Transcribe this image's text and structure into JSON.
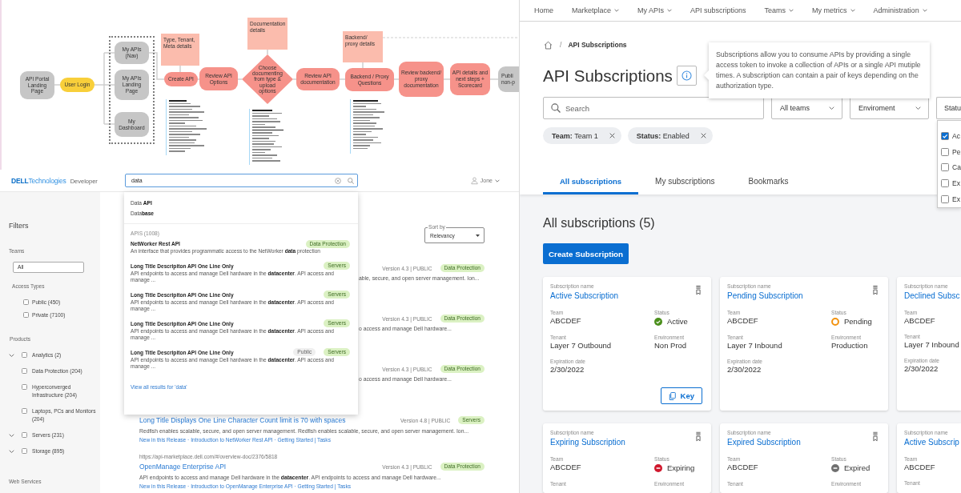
{
  "flowchart": {
    "nodes": [
      {
        "label": "API Portal Landing Page",
        "kind": "process",
        "color": "#c6c6c6"
      },
      {
        "label": "User Login",
        "kind": "process",
        "color": "#f8cf3a"
      },
      {
        "label": "My APIs (Nav)",
        "kind": "process",
        "color": "#c6c6c6"
      },
      {
        "label": "My APIs Landing Page",
        "kind": "process",
        "color": "#c6c6c6"
      },
      {
        "label": "My Dashboard",
        "kind": "process",
        "color": "#c6c6c6"
      },
      {
        "label": "Create API",
        "kind": "process",
        "color": "#f6928a"
      },
      {
        "label": "Review API Options",
        "kind": "process",
        "color": "#f6928a"
      },
      {
        "label": "Choose documenting from type & upload options",
        "kind": "decision",
        "color": "#f6928a"
      },
      {
        "label": "Review API documentation",
        "kind": "process",
        "color": "#f6928a"
      },
      {
        "label": "Backend / Proxy Questions",
        "kind": "process",
        "color": "#f6928a"
      },
      {
        "label": "Review backend/ proxy documentation",
        "kind": "process",
        "color": "#f6928a"
      },
      {
        "label": "API details and next steps + Scorecard",
        "kind": "process",
        "color": "#f6928a"
      },
      {
        "label": "Publi non-p",
        "kind": "process",
        "color": "#c6c6c6"
      }
    ],
    "stickies": [
      {
        "label": "Type, Tenant, Meta details"
      },
      {
        "label": "Documentation details"
      },
      {
        "label": "Backend/ proxy details"
      }
    ]
  },
  "dev_portal": {
    "header": {
      "logo": "**DELL**Technologies",
      "product": "Developer",
      "search": {
        "value": "data"
      },
      "user": "Jone"
    },
    "filters": {
      "title": "Filters",
      "teams": {
        "label": "Teams",
        "value": "All"
      },
      "access": {
        "label": "Access Types",
        "options": [
          {
            "label": "Public (450)",
            "checked": false
          },
          {
            "label": "Private (7100)",
            "checked": false
          }
        ]
      },
      "products": {
        "label": "Products",
        "options": [
          {
            "label": "Analytics (2)",
            "kind": "group",
            "checked": false
          },
          {
            "label": "Data Protection (204)",
            "kind": "item",
            "checked": false
          },
          {
            "label": "Hyperconverged Infrastructure (204)",
            "kind": "item",
            "checked": false
          },
          {
            "label": "Laptops, PCs and Monitors (204)",
            "kind": "item",
            "checked": false
          },
          {
            "label": "Servers (231)",
            "kind": "group",
            "checked": false
          },
          {
            "label": "Storage (895)",
            "kind": "group",
            "checked": false
          }
        ]
      },
      "web_services": {
        "label": "Web Services"
      }
    },
    "suggestions": {
      "terms": [
        "Data **API**",
        "Data**base**"
      ],
      "count": "APIS (1008)",
      "results": [
        {
          "title": "NetWorker Rest API",
          "tags": [
            {
              "label": "Data Protection",
              "kind": "category"
            }
          ],
          "description": "An interface that provides programmatic access to the NetWorker **data** protection"
        },
        {
          "title": "Long Title Descripiton API One Line Only",
          "tags": [
            {
              "label": "Servers",
              "kind": "category"
            }
          ],
          "description": "API endpoints to access and manage Dell hardware in the **datacenter**. API access and manage ..."
        },
        {
          "title": "Long Title Descripiton API One Line Only",
          "tags": [
            {
              "label": "Servers",
              "kind": "category"
            }
          ],
          "description": "API endpoints to access and manage Dell hardware in the **datacenter**. API access and manage ..."
        },
        {
          "title": "Long Title Descripiton API One Line Only",
          "tags": [
            {
              "label": "Servers",
              "kind": "category"
            }
          ],
          "description": "API endpoints to access and manage Dell hardware in the **datacenter**. API access and manage ..."
        },
        {
          "title": "Long Title Descripiton API One Line Only",
          "tags": [
            {
              "label": "Public",
              "kind": "access"
            },
            {
              "label": "Servers",
              "kind": "category"
            }
          ],
          "description": "API endpoints to access and manage Dell hardware in the **datacenter**. API access and manage ..."
        }
      ],
      "view_all": "View all results for 'data'"
    },
    "sort": {
      "label": "Sort by",
      "value": "Relevancy"
    },
    "results": [
      {
        "kind": "partial",
        "meta": "Version 4.3 | PUBLIC",
        "tags": [
          {
            "label": "Data Protection",
            "kind": "category"
          }
        ],
        "description": "able, secure, and open server management. Ion..."
      },
      {
        "kind": "partial",
        "meta": "Version 4.3 | PUBLIC",
        "tags": [
          {
            "label": "Data Protection",
            "kind": "category"
          }
        ],
        "description": "o access and manage Dell hardware..."
      },
      {
        "kind": "partial",
        "meta": "Version 4.3 | PUBLIC",
        "tags": [
          {
            "label": "Data Protection",
            "kind": "category"
          }
        ],
        "description": "o access and manage Dell hardware..."
      },
      {
        "kind": "full",
        "title": "Long Title Displays One Line Character Count limit is 70 with spaces",
        "meta": "Version 4.8 | PUBLIC",
        "tags": [
          {
            "label": "Servers",
            "kind": "category"
          }
        ],
        "description": "Redfish enables scalable, secure, and open server management. Redfish enables scalable, secure, and open server management. Ion...",
        "links": "New in this Release · Introduction to NetWorker Rest API · Getting Started | Tasks"
      },
      {
        "kind": "full",
        "url": "https://api-marketplace.dell.com/#/overview-doc/2376/5818",
        "title": "OpenManage Enterprise API",
        "meta": "Version 4.3 | PUBLIC",
        "tags": [
          {
            "label": "Data Protection",
            "kind": "category"
          }
        ],
        "description": "API endpoints to access and manage Dell hardware in the **datacenter**. API endpoints to access and manage Dell hardware...",
        "links": "New in this Release · Introduction to OpenManage Enterprise API · Getting Started | Tasks"
      }
    ]
  },
  "subscriptions_app": {
    "nav": [
      {
        "label": "Home",
        "menu": false
      },
      {
        "label": "Marketplace",
        "menu": true
      },
      {
        "label": "My APIs",
        "menu": true
      },
      {
        "label": "API subscriptions",
        "menu": false
      },
      {
        "label": "Teams",
        "menu": true
      },
      {
        "label": "My metrics",
        "menu": true
      },
      {
        "label": "Administration",
        "menu": true
      }
    ],
    "breadcrumb": {
      "separator": "/",
      "current": "API Subscriptions"
    },
    "title": "API Subscriptions",
    "tooltip": "Subscriptions allow you to consume APIs by providing a single access token to invoke a collection of APIs or a single API mutiple times. A subscription can contain a pair of keys depending on the authorization type.",
    "search": {
      "placeholder": "Search"
    },
    "selects": [
      {
        "label": "All teams"
      },
      {
        "label": "Enviroment"
      },
      {
        "label": "Statu"
      }
    ],
    "status_options": [
      {
        "label": "Ac",
        "checked": true
      },
      {
        "label": "Pe",
        "checked": false
      },
      {
        "label": "Ca",
        "checked": false
      },
      {
        "label": "Ex",
        "checked": false
      },
      {
        "label": "Ex",
        "checked": false
      }
    ],
    "chips": [
      {
        "text": "**Team:** Team 1"
      },
      {
        "text": "**Status:** Enabled"
      }
    ],
    "tabs": [
      {
        "label": "All subscriptions",
        "selected": true
      },
      {
        "label": "My subscriptions",
        "selected": false
      },
      {
        "label": "Bookmarks",
        "selected": false
      }
    ],
    "heading": "All subscriptions (5)",
    "create_button": "Create Subscription",
    "cards": [
      {
        "name_label": "Subscription name",
        "name": "Active Subscription",
        "bookmark": true,
        "rows": [
          [
            {
              "label": "Team",
              "value": "ABCDEF",
              "kind": "text"
            },
            {
              "label": "Status",
              "value": "Active",
              "kind": "active"
            }
          ],
          [
            {
              "label": "Tenant",
              "value": "Layer 7 Outbound",
              "kind": "text"
            },
            {
              "label": "Environment",
              "value": "Non Prod",
              "kind": "text"
            }
          ],
          [
            {
              "label": "Expiration date",
              "value": "2/30/2022",
              "kind": "text"
            }
          ]
        ],
        "key_button": "Key"
      },
      {
        "name_label": "Subscription name",
        "name": "Pending Subscription",
        "bookmark": true,
        "rows": [
          [
            {
              "label": "Team",
              "value": "ABCDEF",
              "kind": "text"
            },
            {
              "label": "Status",
              "value": "Pending",
              "kind": "pending"
            }
          ],
          [
            {
              "label": "Tenant",
              "value": "Layer 7 Inbound",
              "kind": "text"
            },
            {
              "label": "Environment",
              "value": "Production",
              "kind": "text"
            }
          ],
          [
            {
              "label": "Expiration date",
              "value": "2/30/2022",
              "kind": "text"
            }
          ]
        ]
      },
      {
        "name_label": "Subscription name",
        "name": "Declined Subsc",
        "bookmark": false,
        "rows": [
          [
            {
              "label": "Team",
              "value": "ABCDEF",
              "kind": "text"
            }
          ],
          [
            {
              "label": "Tenant",
              "value": "Layer 7 Inbound",
              "kind": "text"
            }
          ],
          [
            {
              "label": "Expiration date",
              "value": "2/30/2022",
              "kind": "text"
            }
          ]
        ]
      },
      {
        "name_label": "Subscription name",
        "name": "Expiring Subscription",
        "bookmark": true,
        "rows": [
          [
            {
              "label": "Team",
              "value": "ABCDEF",
              "kind": "text"
            },
            {
              "label": "Status",
              "value": "Expiring",
              "kind": "expiring"
            }
          ],
          [
            {
              "label": "Tenant",
              "kind": "text"
            },
            {
              "label": "Environment",
              "kind": "text"
            }
          ]
        ]
      },
      {
        "name_label": "Subscription name",
        "name": "Expired Subscription",
        "bookmark": true,
        "rows": [
          [
            {
              "label": "Team",
              "value": "ABCDEF",
              "kind": "text"
            },
            {
              "label": "Status",
              "value": "Expired",
              "kind": "expired"
            }
          ],
          [
            {
              "label": "Tenant",
              "kind": "text"
            },
            {
              "label": "Environment",
              "kind": "text"
            }
          ]
        ]
      },
      {
        "name_label": "Subscription name",
        "name": "Active Subscrip",
        "bookmark": false,
        "rows": [
          [
            {
              "label": "Team",
              "value": "ABCDEF",
              "kind": "text"
            }
          ],
          [
            {
              "label": "Tenant",
              "kind": "text"
            }
          ]
        ]
      }
    ]
  }
}
